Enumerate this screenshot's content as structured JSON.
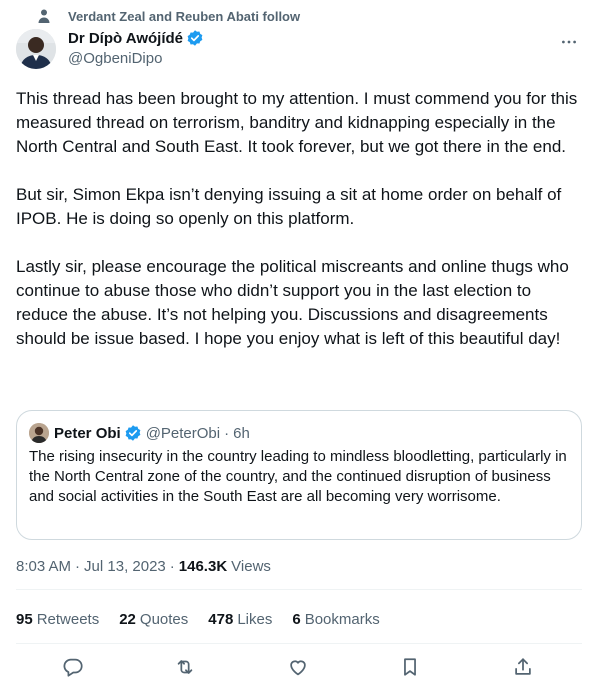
{
  "social_context": {
    "text": "Verdant Zeal and Reuben Abati follow"
  },
  "author": {
    "name": "Dr Dípò Awójídé",
    "handle": "@OgbeniDipo"
  },
  "tweet": {
    "paragraphs": [
      "This thread has been brought to my attention. I must commend you for this measured thread on terrorism, banditry and kidnapping especially in the North Central and South East. It took forever, but we got there in the end.",
      "But sir, Simon Ekpa isn’t denying issuing a sit at home order on behalf of IPOB. He is doing so openly on this platform.",
      "Lastly sir, please encourage the political miscreants and online thugs who continue to abuse those who didn’t support you in the last election to reduce the abuse. It’s not helping you. Discussions and disagreements should be issue based. I hope you enjoy what is left of this beautiful day!"
    ]
  },
  "quote": {
    "name": "Peter Obi",
    "handle": "@PeterObi",
    "dot": "·",
    "time": "6h",
    "text": "The rising insecurity in the country leading to mindless bloodletting, particularly in the North Central zone of the country, and the continued disruption of business and social activities in the South East are all becoming very worrisome."
  },
  "meta": {
    "time": "8:03 AM",
    "dot": "·",
    "date": "Jul 13, 2023",
    "views_count": "146.3K",
    "views_label": "Views"
  },
  "stats": [
    {
      "count": "95",
      "label": "Retweets"
    },
    {
      "count": "22",
      "label": "Quotes"
    },
    {
      "count": "478",
      "label": "Likes"
    },
    {
      "count": "6",
      "label": "Bookmarks"
    }
  ],
  "icons": {
    "social": "person-icon",
    "verified": "verified-badge-icon",
    "more": "more-options-icon",
    "actions": [
      "reply-icon",
      "retweet-icon",
      "like-icon",
      "bookmark-icon",
      "share-icon"
    ]
  },
  "colors": {
    "verified": "#1d9bf0",
    "secondary_text": "#536471",
    "primary_text": "#0f1419",
    "border": "#cfd9de"
  }
}
